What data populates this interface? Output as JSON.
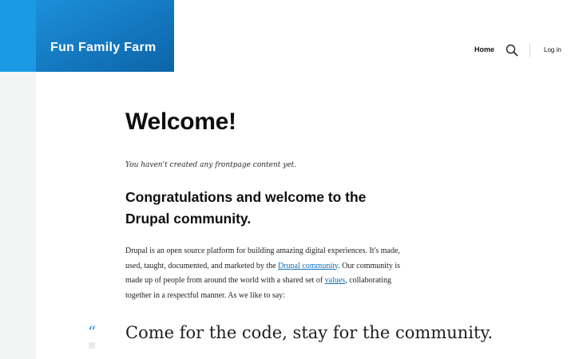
{
  "header": {
    "site_name": "Fun Family Farm",
    "nav": {
      "home_label": "Home",
      "login_label": "Log in"
    },
    "search_icon": "search-icon"
  },
  "main": {
    "title": "Welcome!",
    "empty_message": "You haven't created any frontpage content yet.",
    "subtitle": "Congratulations and welcome to the Drupal community.",
    "paragraph": {
      "part1": "Drupal is an open source platform for building amazing digital experiences. It's made, used, taught, documented, and marketed by the ",
      "link1": "Drupal community",
      "part2": ". Our community is made up of people from around the world with a shared set of ",
      "link2": "values",
      "part3": ", collaborating together in a respectful manner. As we like to say:"
    },
    "quote": {
      "mark": "“",
      "text": "Come for the code, stay for the community."
    }
  },
  "colors": {
    "brand_blue": "#1b9ae4",
    "brand_dark": "#0d64a8",
    "link": "#0f6eb3"
  }
}
